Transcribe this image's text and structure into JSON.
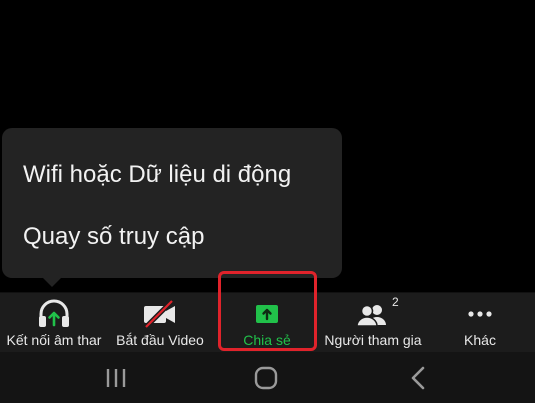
{
  "popup": {
    "items": [
      {
        "label": "Wifi hoặc Dữ liệu di động"
      },
      {
        "label": "Quay số truy cập"
      }
    ]
  },
  "toolbar": {
    "items": [
      {
        "label": "Kết nối âm thar",
        "icon": "headphones-icon"
      },
      {
        "label": "Bắt đầu Video",
        "icon": "video-off-icon"
      },
      {
        "label": "Chia sẻ",
        "icon": "share-screen-icon",
        "active": true,
        "color": "#21c14a"
      },
      {
        "label": "Người tham gia",
        "icon": "participants-icon",
        "badge": "2"
      },
      {
        "label": "Khác",
        "icon": "more-icon"
      }
    ]
  },
  "navbar": {
    "buttons": [
      "recent-apps-icon",
      "home-icon",
      "back-icon"
    ]
  },
  "colors": {
    "background": "#000000",
    "popup": "#232323",
    "toolbar": "#1c1c1c",
    "accent_green": "#21c14a",
    "highlight_red": "#e0232b"
  }
}
